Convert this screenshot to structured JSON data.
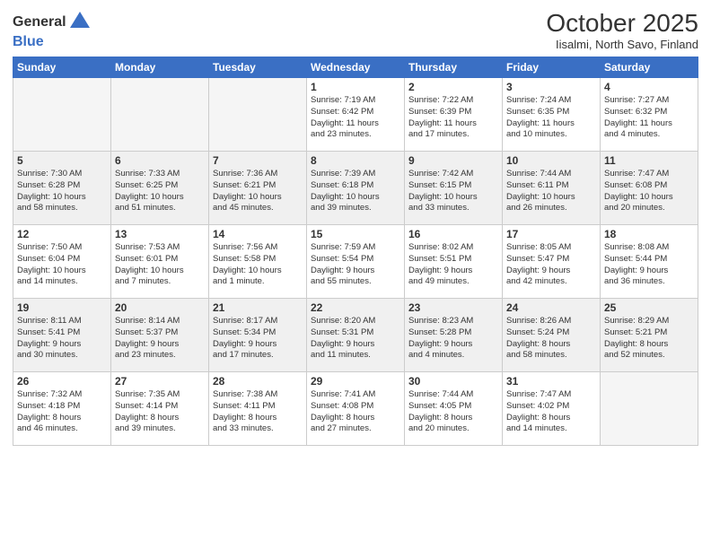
{
  "header": {
    "logo_general": "General",
    "logo_blue": "Blue",
    "month_title": "October 2025",
    "location": "Iisalmi, North Savo, Finland"
  },
  "days_of_week": [
    "Sunday",
    "Monday",
    "Tuesday",
    "Wednesday",
    "Thursday",
    "Friday",
    "Saturday"
  ],
  "weeks": [
    [
      {
        "day": "",
        "detail": ""
      },
      {
        "day": "",
        "detail": ""
      },
      {
        "day": "",
        "detail": ""
      },
      {
        "day": "1",
        "detail": "Sunrise: 7:19 AM\nSunset: 6:42 PM\nDaylight: 11 hours\nand 23 minutes."
      },
      {
        "day": "2",
        "detail": "Sunrise: 7:22 AM\nSunset: 6:39 PM\nDaylight: 11 hours\nand 17 minutes."
      },
      {
        "day": "3",
        "detail": "Sunrise: 7:24 AM\nSunset: 6:35 PM\nDaylight: 11 hours\nand 10 minutes."
      },
      {
        "day": "4",
        "detail": "Sunrise: 7:27 AM\nSunset: 6:32 PM\nDaylight: 11 hours\nand 4 minutes."
      }
    ],
    [
      {
        "day": "5",
        "detail": "Sunrise: 7:30 AM\nSunset: 6:28 PM\nDaylight: 10 hours\nand 58 minutes."
      },
      {
        "day": "6",
        "detail": "Sunrise: 7:33 AM\nSunset: 6:25 PM\nDaylight: 10 hours\nand 51 minutes."
      },
      {
        "day": "7",
        "detail": "Sunrise: 7:36 AM\nSunset: 6:21 PM\nDaylight: 10 hours\nand 45 minutes."
      },
      {
        "day": "8",
        "detail": "Sunrise: 7:39 AM\nSunset: 6:18 PM\nDaylight: 10 hours\nand 39 minutes."
      },
      {
        "day": "9",
        "detail": "Sunrise: 7:42 AM\nSunset: 6:15 PM\nDaylight: 10 hours\nand 33 minutes."
      },
      {
        "day": "10",
        "detail": "Sunrise: 7:44 AM\nSunset: 6:11 PM\nDaylight: 10 hours\nand 26 minutes."
      },
      {
        "day": "11",
        "detail": "Sunrise: 7:47 AM\nSunset: 6:08 PM\nDaylight: 10 hours\nand 20 minutes."
      }
    ],
    [
      {
        "day": "12",
        "detail": "Sunrise: 7:50 AM\nSunset: 6:04 PM\nDaylight: 10 hours\nand 14 minutes."
      },
      {
        "day": "13",
        "detail": "Sunrise: 7:53 AM\nSunset: 6:01 PM\nDaylight: 10 hours\nand 7 minutes."
      },
      {
        "day": "14",
        "detail": "Sunrise: 7:56 AM\nSunset: 5:58 PM\nDaylight: 10 hours\nand 1 minute."
      },
      {
        "day": "15",
        "detail": "Sunrise: 7:59 AM\nSunset: 5:54 PM\nDaylight: 9 hours\nand 55 minutes."
      },
      {
        "day": "16",
        "detail": "Sunrise: 8:02 AM\nSunset: 5:51 PM\nDaylight: 9 hours\nand 49 minutes."
      },
      {
        "day": "17",
        "detail": "Sunrise: 8:05 AM\nSunset: 5:47 PM\nDaylight: 9 hours\nand 42 minutes."
      },
      {
        "day": "18",
        "detail": "Sunrise: 8:08 AM\nSunset: 5:44 PM\nDaylight: 9 hours\nand 36 minutes."
      }
    ],
    [
      {
        "day": "19",
        "detail": "Sunrise: 8:11 AM\nSunset: 5:41 PM\nDaylight: 9 hours\nand 30 minutes."
      },
      {
        "day": "20",
        "detail": "Sunrise: 8:14 AM\nSunset: 5:37 PM\nDaylight: 9 hours\nand 23 minutes."
      },
      {
        "day": "21",
        "detail": "Sunrise: 8:17 AM\nSunset: 5:34 PM\nDaylight: 9 hours\nand 17 minutes."
      },
      {
        "day": "22",
        "detail": "Sunrise: 8:20 AM\nSunset: 5:31 PM\nDaylight: 9 hours\nand 11 minutes."
      },
      {
        "day": "23",
        "detail": "Sunrise: 8:23 AM\nSunset: 5:28 PM\nDaylight: 9 hours\nand 4 minutes."
      },
      {
        "day": "24",
        "detail": "Sunrise: 8:26 AM\nSunset: 5:24 PM\nDaylight: 8 hours\nand 58 minutes."
      },
      {
        "day": "25",
        "detail": "Sunrise: 8:29 AM\nSunset: 5:21 PM\nDaylight: 8 hours\nand 52 minutes."
      }
    ],
    [
      {
        "day": "26",
        "detail": "Sunrise: 7:32 AM\nSunset: 4:18 PM\nDaylight: 8 hours\nand 46 minutes."
      },
      {
        "day": "27",
        "detail": "Sunrise: 7:35 AM\nSunset: 4:14 PM\nDaylight: 8 hours\nand 39 minutes."
      },
      {
        "day": "28",
        "detail": "Sunrise: 7:38 AM\nSunset: 4:11 PM\nDaylight: 8 hours\nand 33 minutes."
      },
      {
        "day": "29",
        "detail": "Sunrise: 7:41 AM\nSunset: 4:08 PM\nDaylight: 8 hours\nand 27 minutes."
      },
      {
        "day": "30",
        "detail": "Sunrise: 7:44 AM\nSunset: 4:05 PM\nDaylight: 8 hours\nand 20 minutes."
      },
      {
        "day": "31",
        "detail": "Sunrise: 7:47 AM\nSunset: 4:02 PM\nDaylight: 8 hours\nand 14 minutes."
      },
      {
        "day": "",
        "detail": ""
      }
    ]
  ]
}
